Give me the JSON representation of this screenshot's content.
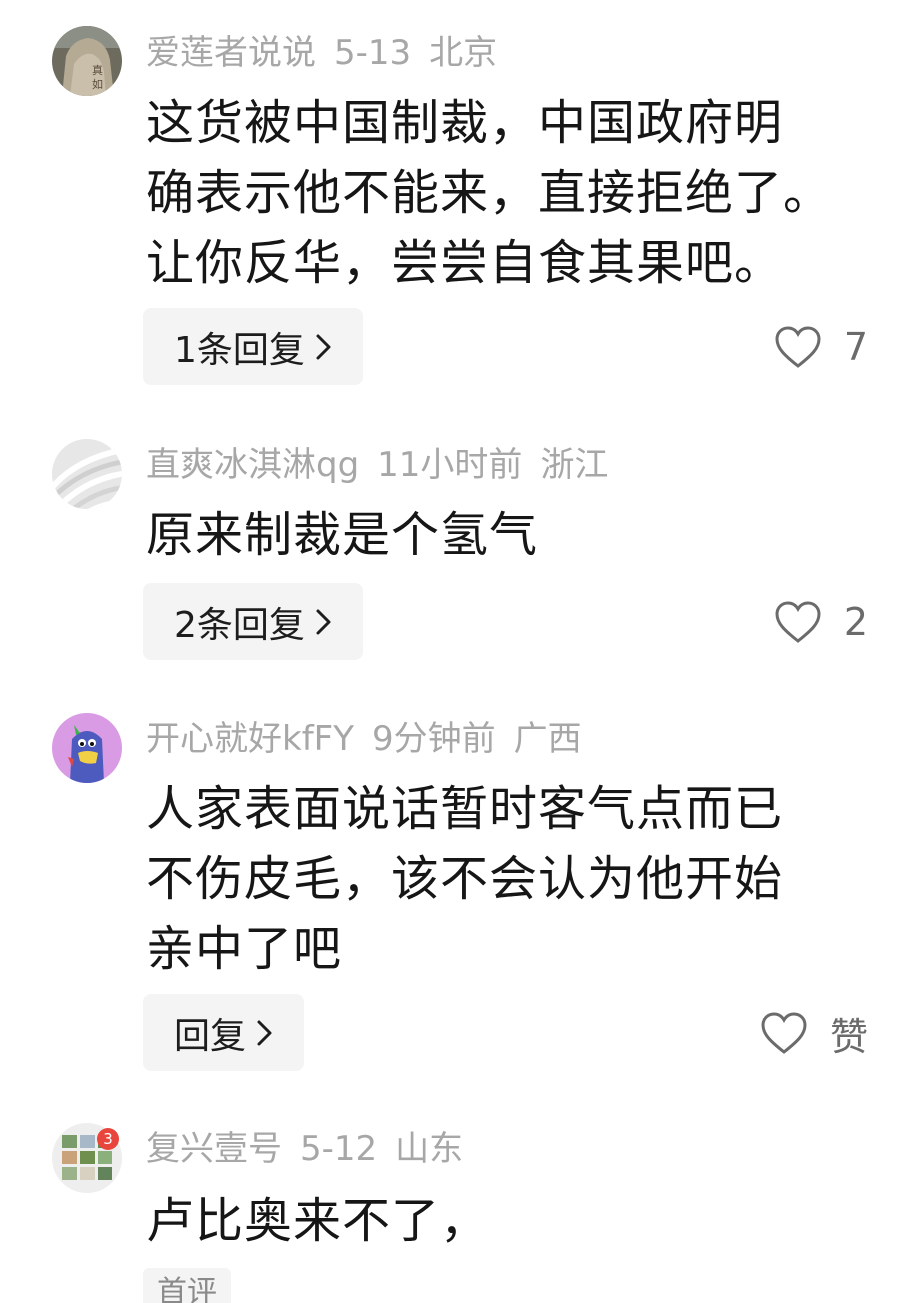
{
  "comments": [
    {
      "username": "爱莲者说说",
      "time": "5-13",
      "location": "北京",
      "lines": [
        "这货被中国制裁，中国政府明",
        "确表示他不能来，直接拒绝了。",
        "让你反华，尝尝自食其果吧。"
      ],
      "reply_label": "1条回复",
      "likes": "7",
      "avatar_icon": "rock-avatar"
    },
    {
      "username": "直爽冰淇淋qg",
      "time": "11小时前",
      "location": "浙江",
      "lines": [
        "原来制裁是个氢气"
      ],
      "reply_label": "2条回复",
      "likes": "2",
      "avatar_icon": "swirl-avatar"
    },
    {
      "username": "开心就好kfFY",
      "time": "9分钟前",
      "location": "广西",
      "lines": [
        "人家表面说话暂时客气点而已",
        "不伤皮毛，该不会认为他开始",
        "亲中了吧"
      ],
      "reply_label": "回复",
      "likes": "赞",
      "avatar_icon": "penguin-avatar"
    },
    {
      "username": "复兴壹号",
      "time": "5-12",
      "location": "山东",
      "lines": [
        "卢比奥来不了，"
      ],
      "tag": "首评",
      "badge": "3",
      "avatar_icon": "photo-grid-avatar"
    }
  ],
  "colors": {
    "meta_text": "#a7a7a7",
    "body_text": "#161616",
    "reply_bg": "#f4f4f4",
    "badge": "#e8453c"
  }
}
